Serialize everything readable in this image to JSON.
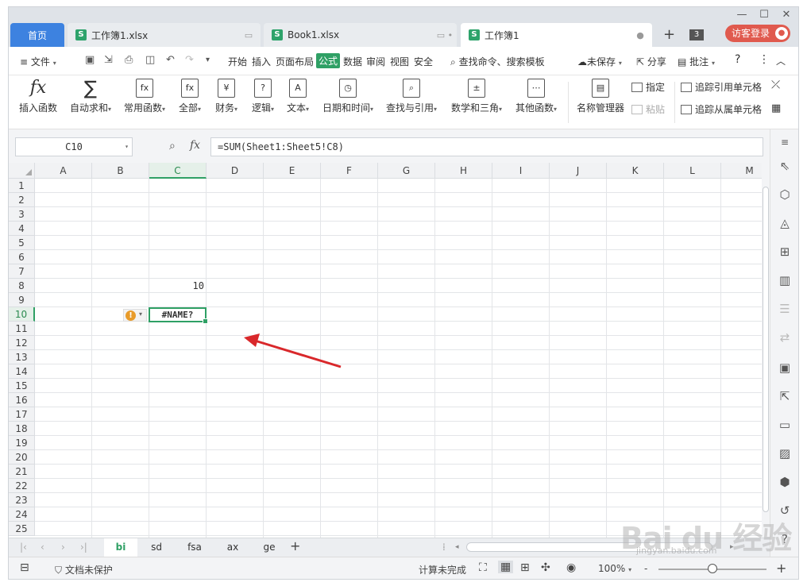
{
  "titlebar": {
    "home_tab": "首页",
    "tabs": [
      {
        "label": "工作簿1.xlsx"
      },
      {
        "label": "Book1.xlsx"
      },
      {
        "label": "工作簿1"
      }
    ],
    "tab_icon": "S",
    "tab_count": "3",
    "login": "访客登录"
  },
  "menubar": {
    "file": "文件",
    "items": [
      "开始",
      "插入",
      "页面布局",
      "公式",
      "数据",
      "审阅",
      "视图",
      "安全"
    ],
    "search": "查找命令、搜索模板",
    "unsaved": "未保存",
    "share": "分享",
    "comment": "批注",
    "help": "?"
  },
  "ribbon": {
    "buttons": [
      "插入函数",
      "自动求和",
      "常用函数",
      "全部",
      "财务",
      "逻辑",
      "文本",
      "日期和时间",
      "查找与引用",
      "数学和三角",
      "其他函数",
      "名称管理器"
    ],
    "specify": "指定",
    "paste": "粘贴",
    "trace_precedents": "追踪引用单元格",
    "trace_dependents": "追踪从属单元格"
  },
  "formulabar": {
    "namebox": "C10",
    "fx": "fx",
    "formula": "=SUM(Sheet1:Sheet5!C8)"
  },
  "grid": {
    "columns": [
      "A",
      "B",
      "C",
      "D",
      "E",
      "F",
      "G",
      "H",
      "I",
      "J",
      "K",
      "L",
      "M"
    ],
    "rows": [
      "1",
      "2",
      "3",
      "4",
      "5",
      "6",
      "7",
      "8",
      "9",
      "10",
      "11",
      "12",
      "13",
      "14",
      "15",
      "16",
      "17",
      "18",
      "19",
      "20",
      "21",
      "22",
      "23",
      "24",
      "25"
    ],
    "c8_value": "10",
    "c10_value": "#NAME?",
    "selected_col": "C",
    "selected_row": "10",
    "error_symbol": "!"
  },
  "sheets": {
    "tabs": [
      "bi",
      "sd",
      "fsa",
      "ax",
      "ge"
    ],
    "active": "bi",
    "add": "+"
  },
  "statusbar": {
    "protect": "文档未保护",
    "calc": "计算未完成",
    "zoom": "100%",
    "zoom_out": "-",
    "zoom_in": "+"
  },
  "colors": {
    "accent": "#2fa065",
    "home_tab": "#3d82e0",
    "login": "#e05a4e",
    "arrow": "#d9282b"
  },
  "watermark": {
    "logo": "Bai du 经验",
    "url": "jingyan.baidu.com"
  }
}
